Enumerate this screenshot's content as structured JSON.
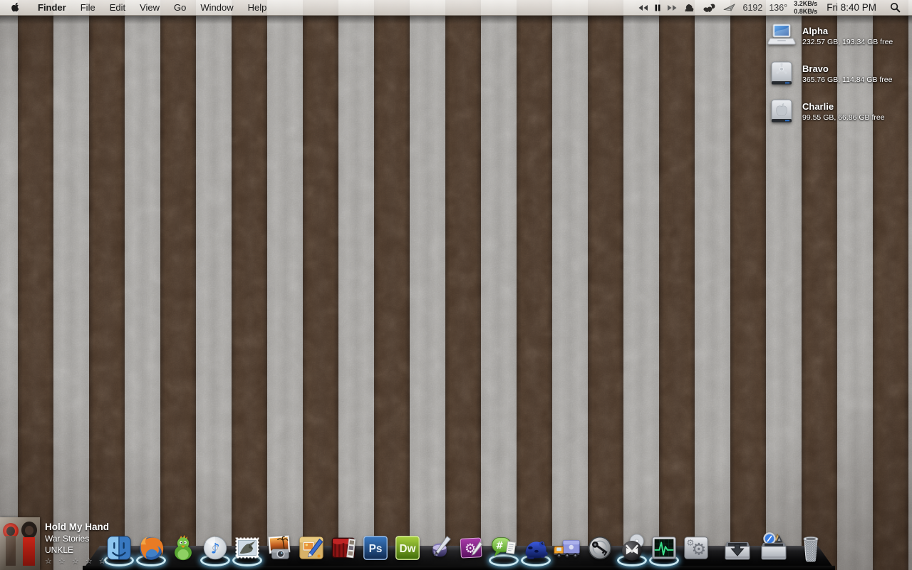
{
  "menubar": {
    "apple_menu_label": "apple-menu",
    "menus": [
      "Finder",
      "File",
      "Edit",
      "View",
      "Go",
      "Window",
      "Help"
    ],
    "status": {
      "counter": "6192",
      "temperature": "136°",
      "net_up": "3.2KB/s",
      "net_down": "0.8KB/s",
      "clock": "Fri 8:40 PM"
    }
  },
  "desktop": {
    "drives": [
      {
        "name": "Alpha",
        "info": "232.57 GB, 193.34 GB free",
        "icon": "laptop-drive-icon"
      },
      {
        "name": "Bravo",
        "info": "365.76 GB, 114.84 GB free",
        "icon": "firewire-drive-icon"
      },
      {
        "name": "Charlie",
        "info": "99.55 GB, 66.86 GB free",
        "icon": "apple-drive-icon"
      }
    ],
    "wallpaper": {
      "stripe_brown": "#4b3a2d",
      "stripe_gray": "#a3a19e",
      "style": "vertical damask stripes"
    }
  },
  "now_playing": {
    "title": "Hold My Hand",
    "album": "War Stories",
    "artist": "UNKLE",
    "rating": "☆ ☆ ☆ ☆ ☆"
  },
  "dock": {
    "badges": {
      "ps": "Ps",
      "dw": "Dw"
    },
    "running_indicator_color": "#aee4ff",
    "apps": [
      {
        "name": "Finder",
        "running": true
      },
      {
        "name": "Firefox",
        "running": true
      },
      {
        "name": "Adium",
        "running": false
      },
      {
        "name": "iTunes",
        "running": true
      },
      {
        "name": "Mail",
        "running": true
      },
      {
        "name": "iPhoto",
        "running": false
      },
      {
        "name": "Image Editor",
        "running": false
      },
      {
        "name": "Photo Booth",
        "running": false
      },
      {
        "name": "Photoshop",
        "running": false
      },
      {
        "name": "Dreamweaver",
        "running": false
      },
      {
        "name": "Pages",
        "running": false
      },
      {
        "name": "Graphics Utility",
        "running": false
      },
      {
        "name": "Colloquy",
        "running": true
      },
      {
        "name": "Blue Frog App",
        "running": true
      },
      {
        "name": "Transmit",
        "running": false
      },
      {
        "name": "Security Utility",
        "running": false
      },
      {
        "name": "Bowtie",
        "running": true
      },
      {
        "name": "Activity Monitor",
        "running": true
      },
      {
        "name": "System Preferences",
        "running": false
      }
    ],
    "stacks": [
      {
        "name": "Downloads"
      },
      {
        "name": "Applications"
      }
    ],
    "trash": {
      "name": "Trash",
      "state": "empty"
    }
  }
}
